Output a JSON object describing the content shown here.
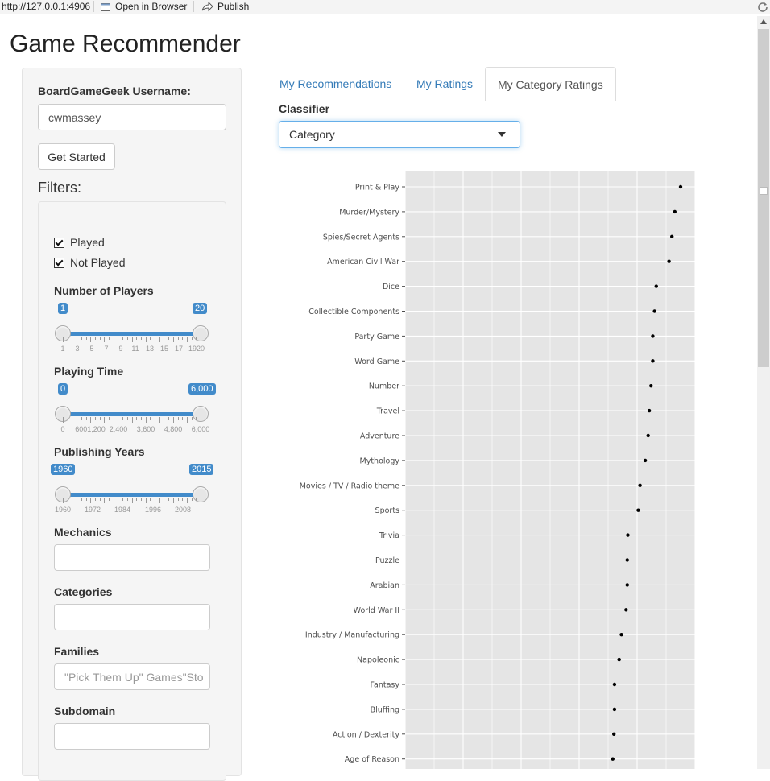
{
  "topbar": {
    "url": "http://127.0.0.1:4906",
    "open_browser": "Open in Browser",
    "publish": "Publish"
  },
  "app": {
    "title": "Game Recommender"
  },
  "sidebar": {
    "username_label": "BoardGameGeek Username:",
    "username_value": "cwmassey",
    "get_started": "Get Started",
    "filters_label": "Filters:",
    "played": "Played",
    "not_played": "Not Played",
    "players": {
      "label": "Number of Players",
      "min": "1",
      "max": "20",
      "ticks": [
        "1",
        "3",
        "5",
        "7",
        "9",
        "11",
        "13",
        "15",
        "17",
        "1920"
      ]
    },
    "playing_time": {
      "label": "Playing Time",
      "min": "0",
      "max": "6,000",
      "ticks": [
        "0",
        "6001,200",
        "2,400",
        "3,600",
        "4,800",
        "6,000"
      ]
    },
    "years": {
      "label": "Publishing Years",
      "min": "1960",
      "max": "2015",
      "ticks": [
        "1960",
        "1972",
        "1984",
        "1996",
        "2008"
      ]
    },
    "mechanics_label": "Mechanics",
    "categories_label": "Categories",
    "families_label": "Families",
    "families_placeholder": "\"Pick Them Up\" Games\"Sto",
    "subdomain_label": "Subdomain"
  },
  "tabs": [
    {
      "label": "My Recommendations"
    },
    {
      "label": "My Ratings"
    },
    {
      "label": "My Category Ratings"
    }
  ],
  "classifier": {
    "label": "Classifier",
    "selected": "Category"
  },
  "chart_data": {
    "type": "scatter",
    "title": "",
    "xlabel": "",
    "ylabel": "",
    "grid": true,
    "categories": [
      "Print & Play",
      "Murder/Mystery",
      "Spies/Secret Agents",
      "American Civil War",
      "Dice",
      "Collectible Components",
      "Party Game",
      "Word Game",
      "Number",
      "Travel",
      "Adventure",
      "Mythology",
      "Movies / TV / Radio theme",
      "Sports",
      "Trivia",
      "Puzzle",
      "Arabian",
      "World War II",
      "Industry / Manufacturing",
      "Napoleonic",
      "Fantasy",
      "Bluffing",
      "Action / Dexterity",
      "Age of Reason"
    ],
    "values": [
      8.75,
      8.65,
      8.6,
      8.55,
      8.33,
      8.3,
      8.27,
      8.27,
      8.24,
      8.21,
      8.19,
      8.14,
      8.05,
      8.02,
      7.84,
      7.83,
      7.83,
      7.81,
      7.73,
      7.69,
      7.61,
      7.61,
      7.6,
      7.58
    ],
    "xlim": [
      4.0,
      9.0
    ]
  }
}
